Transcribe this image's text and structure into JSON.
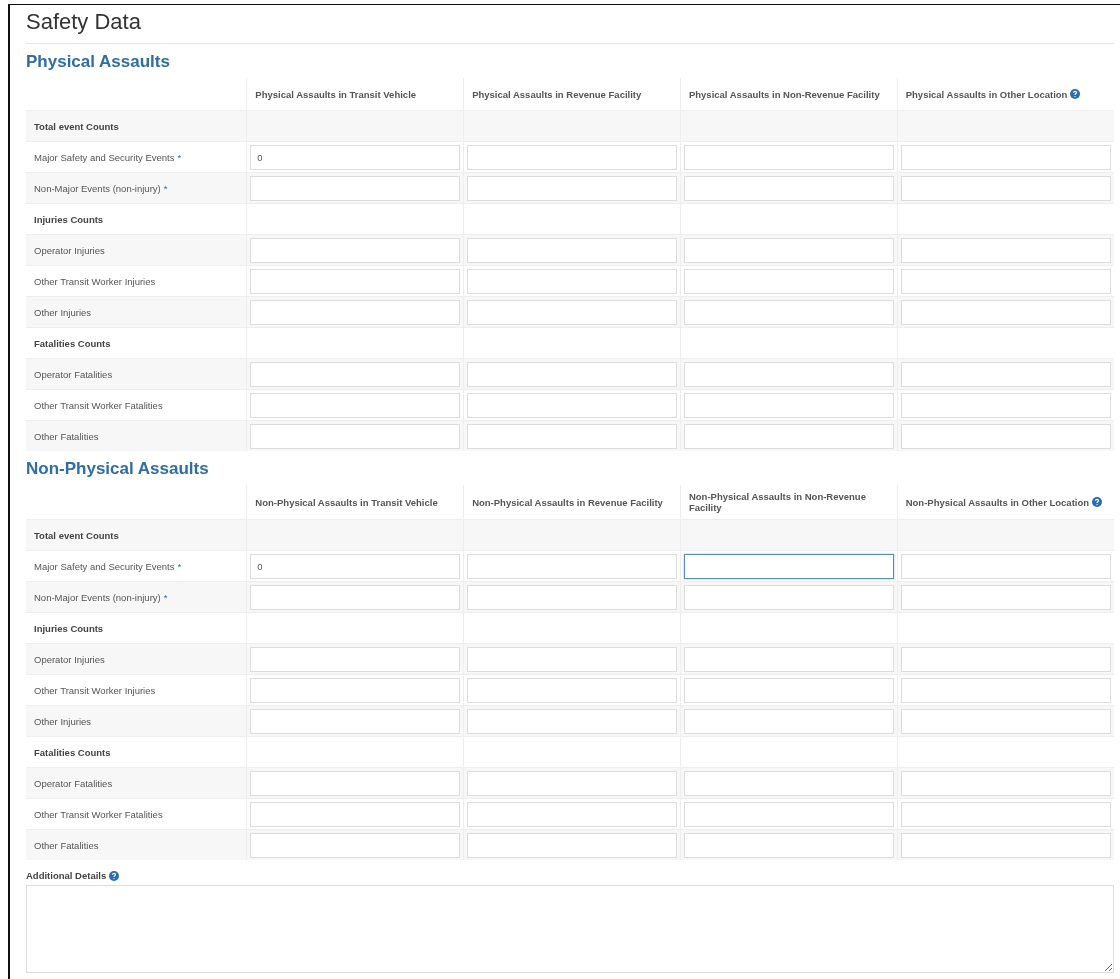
{
  "title": "Safety Data",
  "sections": [
    {
      "title": "Physical Assaults",
      "columns": [
        {
          "label": "Physical Assaults in Transit Vehicle",
          "help": false
        },
        {
          "label": "Physical Assaults in Revenue Facility",
          "help": false
        },
        {
          "label": "Physical Assaults in Non-Revenue Facility",
          "help": false
        },
        {
          "label": "Physical Assaults in Other Location",
          "help": true
        }
      ],
      "rows": [
        {
          "kind": "group",
          "label": "Total event Counts"
        },
        {
          "kind": "field",
          "label": "Major Safety and Security Events",
          "required_mark": "*",
          "cells": [
            {
              "value": "0",
              "focused": false
            },
            {
              "focused": false
            },
            {
              "focused": false
            },
            {
              "focused": false
            }
          ]
        },
        {
          "kind": "field",
          "label": "Non-Major Events (non-injury)",
          "required_mark": "*",
          "cells": [
            {
              "focused": false
            },
            {
              "focused": false
            },
            {
              "focused": false
            },
            {
              "focused": false
            }
          ]
        },
        {
          "kind": "group",
          "label": "Injuries Counts"
        },
        {
          "kind": "field",
          "label": "Operator Injuries",
          "cells": [
            {
              "focused": false
            },
            {
              "focused": false
            },
            {
              "focused": false
            },
            {
              "focused": false
            }
          ]
        },
        {
          "kind": "field",
          "label": "Other Transit Worker Injuries",
          "cells": [
            {
              "focused": false
            },
            {
              "focused": false
            },
            {
              "focused": false
            },
            {
              "focused": false
            }
          ]
        },
        {
          "kind": "field",
          "label": "Other Injuries",
          "cells": [
            {
              "focused": false
            },
            {
              "focused": false
            },
            {
              "focused": false
            },
            {
              "focused": false
            }
          ]
        },
        {
          "kind": "group",
          "label": "Fatalities Counts"
        },
        {
          "kind": "field",
          "label": "Operator Fatalities",
          "cells": [
            {
              "focused": false
            },
            {
              "focused": false
            },
            {
              "focused": false
            },
            {
              "focused": false
            }
          ]
        },
        {
          "kind": "field",
          "label": "Other Transit Worker Fatalities",
          "cells": [
            {
              "focused": false
            },
            {
              "focused": false
            },
            {
              "focused": false
            },
            {
              "focused": false
            }
          ]
        },
        {
          "kind": "field",
          "label": "Other Fatalities",
          "cells": [
            {
              "focused": false
            },
            {
              "focused": false
            },
            {
              "focused": false
            },
            {
              "focused": false
            }
          ]
        }
      ]
    },
    {
      "title": "Non-Physical Assaults",
      "columns": [
        {
          "label": "Non-Physical Assaults in Transit Vehicle",
          "help": false
        },
        {
          "label": "Non-Physical Assaults in Revenue Facility",
          "help": false
        },
        {
          "label": "Non-Physical Assaults in Non-Revenue Facility",
          "help": false
        },
        {
          "label": "Non-Physical Assaults in Other Location",
          "help": true
        }
      ],
      "rows": [
        {
          "kind": "group",
          "label": "Total event Counts"
        },
        {
          "kind": "field",
          "label": "Major Safety and Security Events",
          "required_mark": "*",
          "cells": [
            {
              "value": "0",
              "focused": false
            },
            {
              "focused": false
            },
            {
              "focused": true
            },
            {
              "focused": false
            }
          ]
        },
        {
          "kind": "field",
          "label": "Non-Major Events (non-injury)",
          "required_mark": "*",
          "cells": [
            {
              "focused": false
            },
            {
              "focused": false
            },
            {
              "focused": false
            },
            {
              "focused": false
            }
          ]
        },
        {
          "kind": "group",
          "label": "Injuries Counts"
        },
        {
          "kind": "field",
          "label": "Operator Injuries",
          "cells": [
            {
              "focused": false
            },
            {
              "focused": false
            },
            {
              "focused": false
            },
            {
              "focused": false
            }
          ]
        },
        {
          "kind": "field",
          "label": "Other Transit Worker Injuries",
          "cells": [
            {
              "focused": false
            },
            {
              "focused": false
            },
            {
              "focused": false
            },
            {
              "focused": false
            }
          ]
        },
        {
          "kind": "field",
          "label": "Other Injuries",
          "cells": [
            {
              "focused": false
            },
            {
              "focused": false
            },
            {
              "focused": false
            },
            {
              "focused": false
            }
          ]
        },
        {
          "kind": "group",
          "label": "Fatalities Counts"
        },
        {
          "kind": "field",
          "label": "Operator Fatalities",
          "cells": [
            {
              "focused": false
            },
            {
              "focused": false
            },
            {
              "focused": false
            },
            {
              "focused": false
            }
          ]
        },
        {
          "kind": "field",
          "label": "Other Transit Worker Fatalities",
          "cells": [
            {
              "focused": false
            },
            {
              "focused": false
            },
            {
              "focused": false
            },
            {
              "focused": false
            }
          ]
        },
        {
          "kind": "field",
          "label": "Other Fatalities",
          "cells": [
            {
              "focused": false
            },
            {
              "focused": false
            },
            {
              "focused": false
            },
            {
              "focused": false
            }
          ]
        }
      ]
    }
  ],
  "additional_details": {
    "label": "Additional Details",
    "help": true
  }
}
